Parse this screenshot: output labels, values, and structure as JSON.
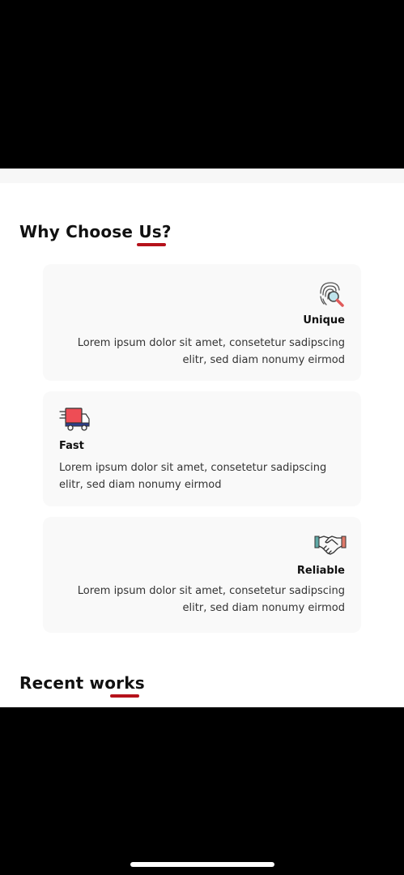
{
  "why_choose_us": {
    "heading": "Why Choose Us?",
    "cards": [
      {
        "title": "Unique",
        "description": "Lorem ipsum dolor sit amet, consetetur sadipscing elitr, sed diam nonumy eirmod",
        "icon": "fingerprint-search-icon",
        "align": "right"
      },
      {
        "title": "Fast",
        "description": "Lorem ipsum dolor sit amet, consetetur sadipscing elitr, sed diam nonumy eirmod",
        "icon": "delivery-truck-icon",
        "align": "left"
      },
      {
        "title": "Reliable",
        "description": "Lorem ipsum dolor sit amet, consetetur sadipscing elitr, sed diam nonumy eirmod",
        "icon": "handshake-icon",
        "align": "right"
      }
    ]
  },
  "recent_works": {
    "heading": "Recent works"
  },
  "colors": {
    "accent": "#b5121b",
    "card_bg": "#f9f9f9",
    "text": "#111111",
    "body_text": "#333333"
  }
}
